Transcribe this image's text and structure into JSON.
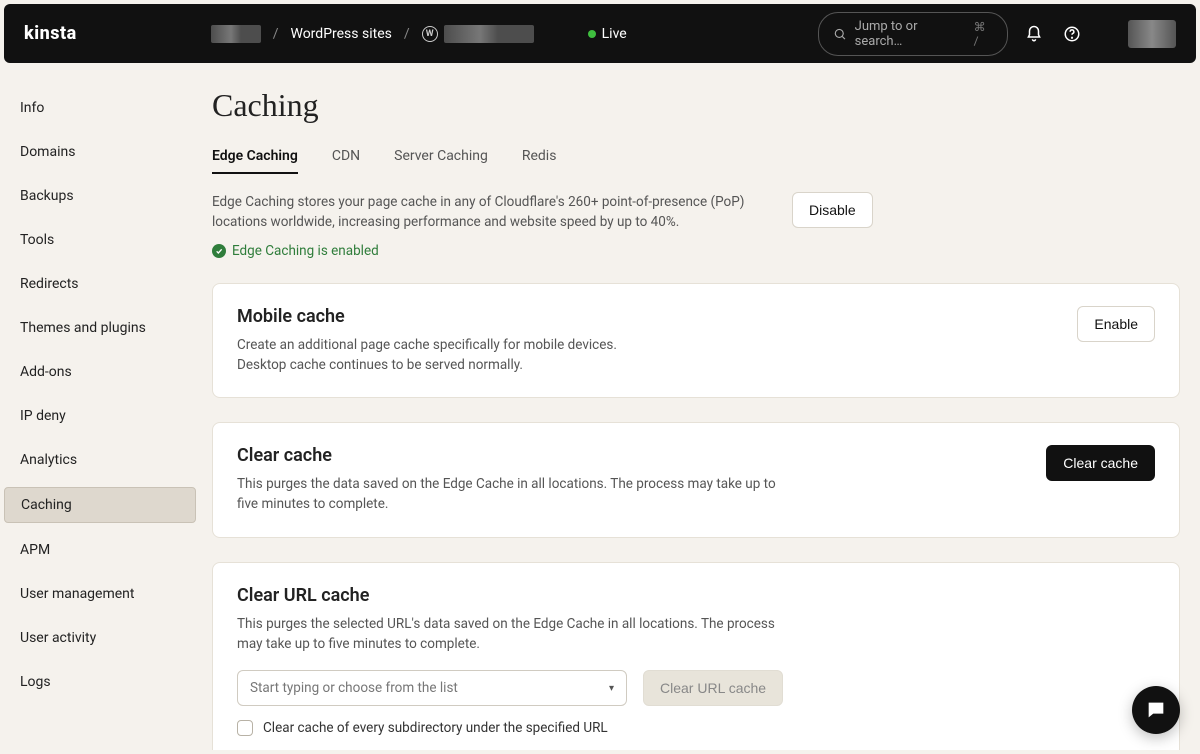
{
  "topbar": {
    "logo": "kinsta",
    "breadcrumb_link": "WordPress sites",
    "env_label": "Live",
    "search_placeholder": "Jump to or search…",
    "search_kbd": "⌘ /"
  },
  "sidebar": {
    "items": [
      "Info",
      "Domains",
      "Backups",
      "Tools",
      "Redirects",
      "Themes and plugins",
      "Add-ons",
      "IP deny",
      "Analytics",
      "Caching",
      "APM",
      "User management",
      "User activity",
      "Logs"
    ],
    "active_index": 9
  },
  "page": {
    "title": "Caching",
    "tabs": [
      "Edge Caching",
      "CDN",
      "Server Caching",
      "Redis"
    ],
    "active_tab_index": 0,
    "intro": "Edge Caching stores your page cache in any of Cloudflare's 260+ point-of-presence (PoP) locations worldwide, increasing performance and website speed by up to 40%.",
    "status": "Edge Caching is enabled",
    "disable_btn": "Disable"
  },
  "mobile_card": {
    "title": "Mobile cache",
    "desc1": "Create an additional page cache specifically for mobile devices.",
    "desc2": "Desktop cache continues to be served normally.",
    "btn": "Enable"
  },
  "clear_card": {
    "title": "Clear cache",
    "desc": "This purges the data saved on the Edge Cache in all locations. The process may take up to five minutes to complete.",
    "btn": "Clear cache"
  },
  "url_card": {
    "title": "Clear URL cache",
    "desc": "This purges the selected URL's data saved on the Edge Cache in all locations. The process may take up to five minutes to complete.",
    "combo_placeholder": "Start typing or choose from the list",
    "btn": "Clear URL cache",
    "checkbox_label": "Clear cache of every subdirectory under the specified URL"
  }
}
